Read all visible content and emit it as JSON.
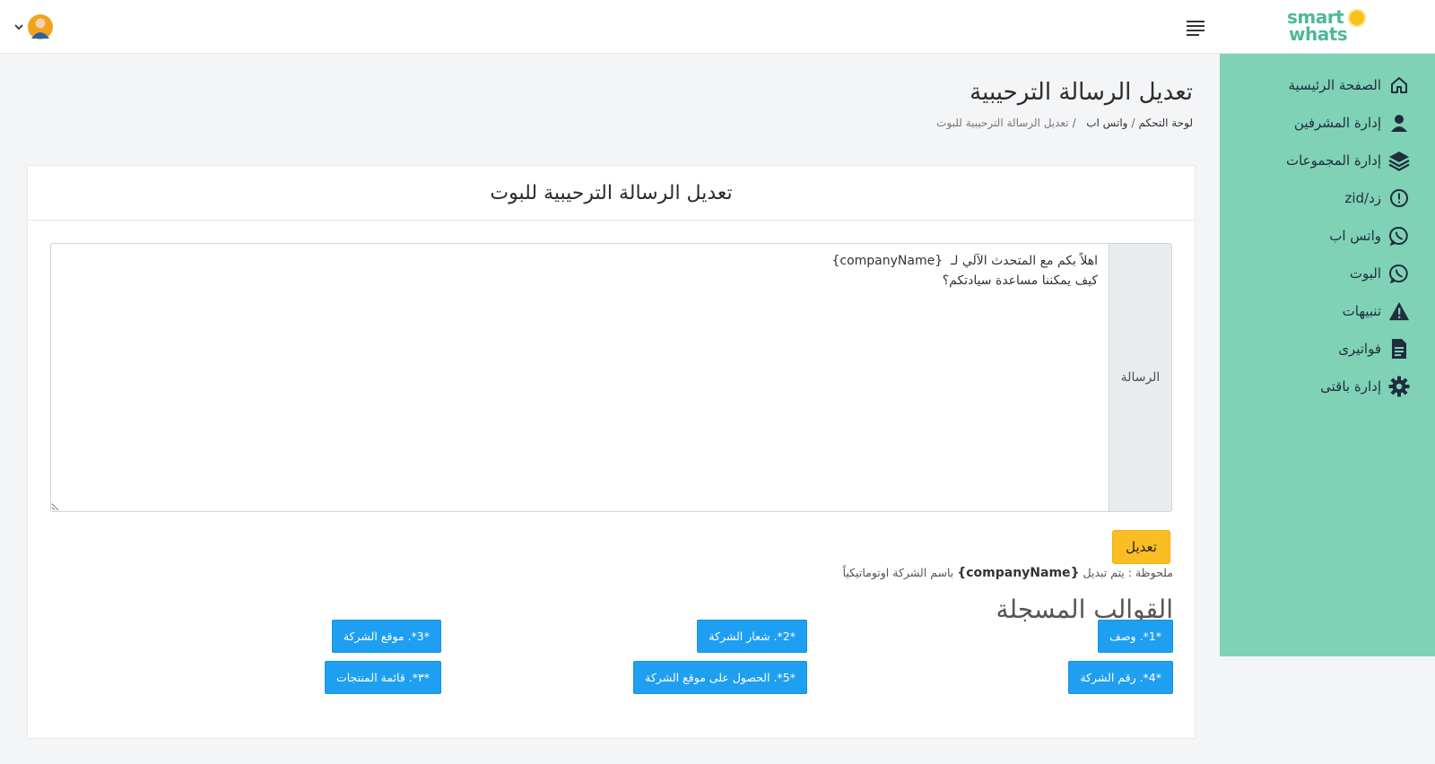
{
  "topbar": {
    "logo_line1": "smart",
    "logo_line2": "whats",
    "accent": "#4fb89a"
  },
  "sidebar": {
    "background": "#7fd2b5",
    "items": [
      {
        "label": "الصفحة الرئيسية",
        "icon": "home-icon"
      },
      {
        "label": "إدارة المشرفين",
        "icon": "user-icon"
      },
      {
        "label": "إدارة المجموعات",
        "icon": "layers-icon"
      },
      {
        "label": "زد/zid",
        "icon": "alert-circle-icon"
      },
      {
        "label": "واتس اب",
        "icon": "whatsapp-icon"
      },
      {
        "label": "البوت",
        "icon": "whatsapp-icon"
      },
      {
        "label": "تنبيهات",
        "icon": "warning-icon"
      },
      {
        "label": "فواتيرى",
        "icon": "invoice-icon"
      },
      {
        "label": "إدارة باقتى",
        "icon": "gear-icon"
      }
    ]
  },
  "header": {
    "title": "تعديل الرسالة الترحيبية",
    "breadcrumb": {
      "dashboard": "لوحة التحكم",
      "whatsapp": "واتس اب",
      "current": "تعديل الرسالة الترحيبية للبوت"
    }
  },
  "card": {
    "title": "تعديل الرسالة الترحيبية للبوت",
    "message_label": "الرسالة",
    "message_value": "اهلاً بكم مع المتحدث الآلي لـ  {companyName}\nكيف يمكننا مساعدة سيادتكم؟",
    "edit_button": "تعديل",
    "note_prefix": "ملحوظة : يتم تبديل",
    "note_token": "{companyName}",
    "note_suffix": "باسم الشركة اوتوماتيكياً",
    "templates_title": "القوالب المسجلة",
    "templates": [
      "*1*. وصف",
      "*2*. شعار الشركة",
      "*3*. موقع الشركة",
      "*4*. رقم الشركة",
      "*5*. الحصول على موقع الشركة",
      "*٣*. قائمة المنتجات"
    ],
    "colors": {
      "edit_button": "#fbbd24",
      "template_button": "#1e9ff2"
    }
  }
}
